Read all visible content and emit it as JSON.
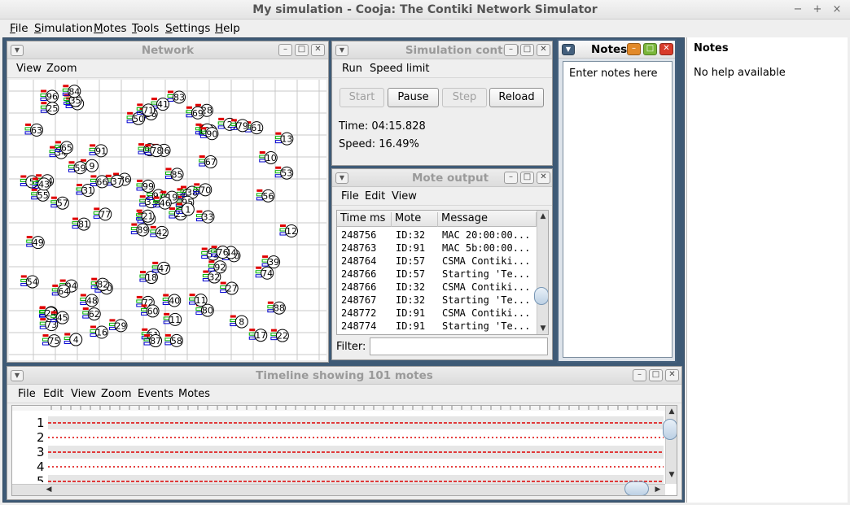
{
  "app": {
    "title": "My simulation - Cooja: The Contiki Network Simulator",
    "menu": [
      "File",
      "Simulation",
      "Motes",
      "Tools",
      "Settings",
      "Help"
    ],
    "window_controls": [
      "−",
      "+",
      "×"
    ]
  },
  "network": {
    "title": "Network",
    "menu": [
      "View",
      "Zoom"
    ],
    "motes": [
      "42",
      "34",
      "6",
      "15",
      "68",
      "30",
      "28",
      "26",
      "98",
      "23",
      "3",
      "22",
      "57",
      "13",
      "89",
      "67",
      "4",
      "93",
      "85",
      "94",
      "86",
      "73",
      "62",
      "78",
      "38",
      "20",
      "65",
      "36",
      "55",
      "52",
      "53",
      "21",
      "72",
      "33",
      "91",
      "2",
      "82",
      "17",
      "88",
      "44",
      "83",
      "37",
      "31",
      "32",
      "16",
      "5",
      "95",
      "75",
      "60",
      "1",
      "64",
      "10",
      "63",
      "92",
      "80",
      "48",
      "35",
      "96",
      "40",
      "61",
      "41",
      "77",
      "14",
      "9",
      "79",
      "84",
      "69",
      "50",
      "97",
      "54",
      "18",
      "29",
      "76",
      "66",
      "24",
      "25",
      "59",
      "49",
      "99",
      "11",
      "19",
      "45",
      "33",
      "39",
      "51",
      "56",
      "47",
      "8",
      "58",
      "11",
      "71",
      "12",
      "70",
      "27",
      "46",
      "74",
      "43",
      "87",
      "100",
      "90",
      "81"
    ]
  },
  "sim_control": {
    "title": "Simulation control",
    "menu": [
      "Run",
      "Speed limit"
    ],
    "buttons": {
      "start": "Start",
      "pause": "Pause",
      "step": "Step",
      "reload": "Reload"
    },
    "time": "Time: 04:15.828",
    "speed": "Speed: 16.49%"
  },
  "mote_output": {
    "title": "Mote output",
    "menu": [
      "File",
      "Edit",
      "View"
    ],
    "columns": [
      "Time ms",
      "Mote",
      "Message"
    ],
    "rows": [
      [
        "248756",
        "ID:32",
        "MAC 20:00:00..."
      ],
      [
        "248763",
        "ID:91",
        "MAC 5b:00:00..."
      ],
      [
        "248764",
        "ID:57",
        "CSMA Contiki..."
      ],
      [
        "248766",
        "ID:57",
        "Starting 'Te..."
      ],
      [
        "248766",
        "ID:32",
        "CSMA Contiki..."
      ],
      [
        "248767",
        "ID:32",
        "Starting 'Te..."
      ],
      [
        "248772",
        "ID:91",
        "CSMA Contiki..."
      ],
      [
        "248774",
        "ID:91",
        "Starting 'Te..."
      ]
    ],
    "filter_label": "Filter:"
  },
  "notes": {
    "title": "Notes",
    "content": "Enter notes here"
  },
  "help_pane": {
    "title": "Notes",
    "text": "No help available"
  },
  "timeline": {
    "title": "Timeline showing 101 motes",
    "menu": [
      "File",
      "Edit",
      "View",
      "Zoom",
      "Events",
      "Motes"
    ],
    "rows": [
      "1",
      "2",
      "3",
      "4",
      "5"
    ]
  },
  "colors": {
    "desktop": "#3e5a76",
    "active_frame": "#44607d",
    "led_red": "#e00000",
    "led_green": "#00b000",
    "led_blue": "#0000d0"
  }
}
